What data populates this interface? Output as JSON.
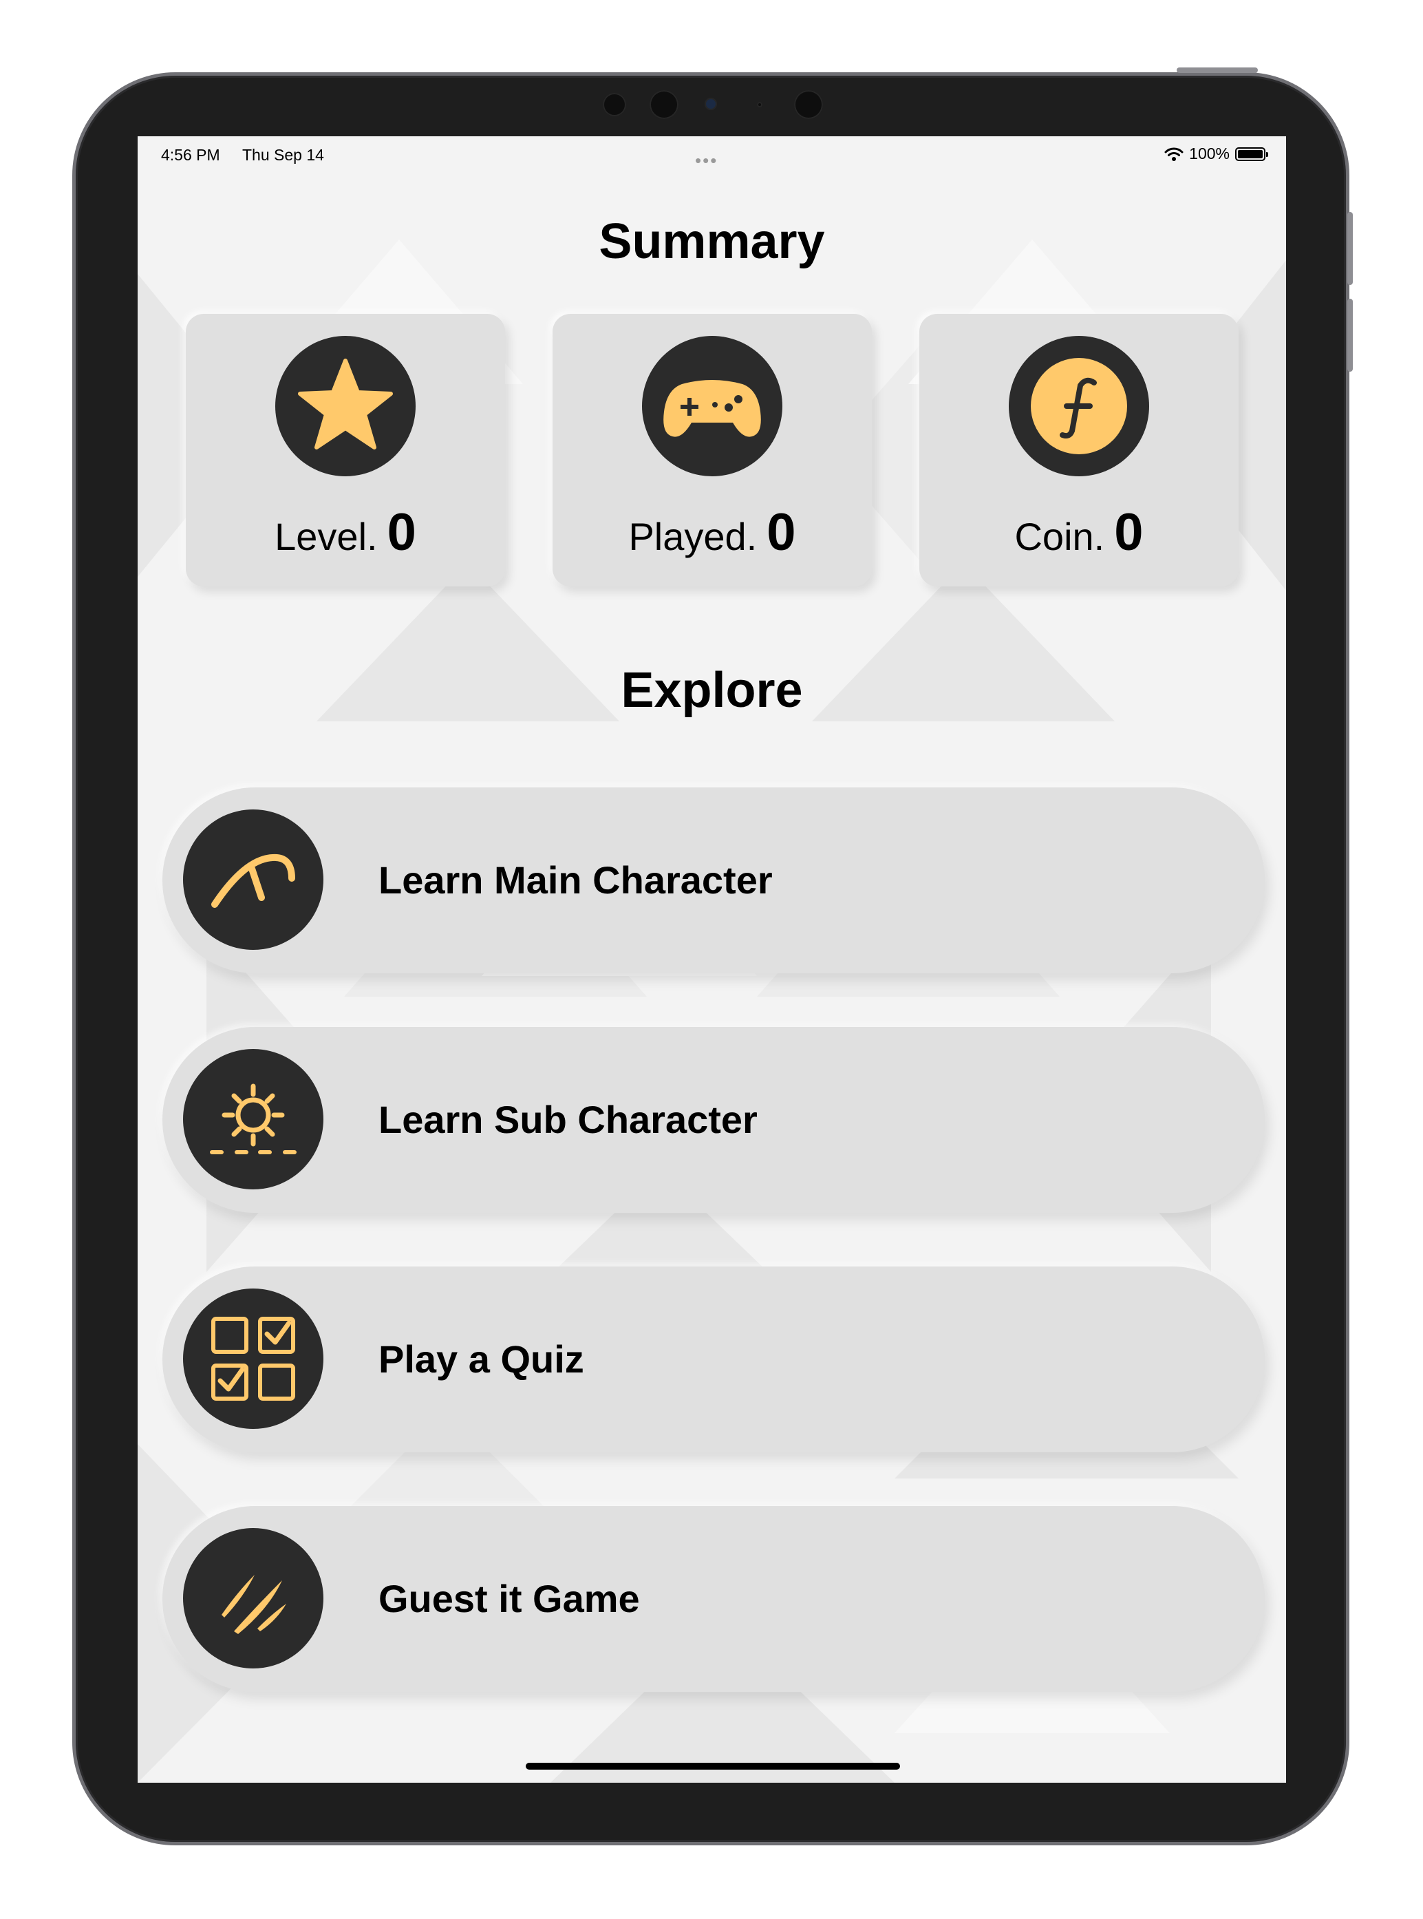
{
  "status_bar": {
    "time": "4:56 PM",
    "date": "Thu Sep 14",
    "dots": "•••",
    "battery_percent": "100%",
    "wifi_icon": "wifi-icon",
    "battery_icon": "battery-icon"
  },
  "summary": {
    "title": "Summary",
    "cards": [
      {
        "label": "Level.",
        "value": "0",
        "icon": "star-icon"
      },
      {
        "label": "Played.",
        "value": "0",
        "icon": "gamepad-icon"
      },
      {
        "label": "Coin.",
        "value": "0",
        "icon": "coin-icon"
      }
    ]
  },
  "explore": {
    "title": "Explore",
    "items": [
      {
        "label": "Learn Main Character",
        "icon": "main-character-glyph-icon"
      },
      {
        "label": "Learn Sub Character",
        "icon": "sub-character-glyph-icon"
      },
      {
        "label": "Play a Quiz",
        "icon": "quiz-checklist-icon"
      },
      {
        "label": "Guest it Game",
        "icon": "slashes-icon"
      }
    ]
  },
  "colors": {
    "accent": "#ffc96b",
    "icon_bg": "#2b2b2b",
    "card_bg": "#e0e0e0",
    "screen_bg": "#f1f1f1"
  }
}
